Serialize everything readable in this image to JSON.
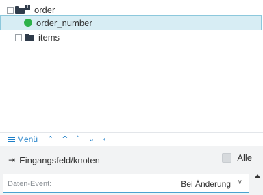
{
  "tree": {
    "nodes": [
      {
        "label": "order",
        "type": "folder-badged",
        "badge": "1"
      },
      {
        "label": "order_number",
        "type": "leaf",
        "status_color": "#2db24a"
      },
      {
        "label": "items",
        "type": "folder"
      }
    ]
  },
  "toolbar": {
    "menu_label": "Menü",
    "icons": [
      "double-chevron-up-icon",
      "chevron-up-icon",
      "chevron-down-icon",
      "double-chevron-down-icon",
      "chevron-left-icon"
    ]
  },
  "panel": {
    "field_label": "Eingangsfeld/knoten",
    "all_label": "Alle",
    "event": {
      "label": "Daten-Event:",
      "value": "Bei Änderung"
    }
  },
  "colors": {
    "accent": "#1e7fc8",
    "selection_bg": "#d7edf4",
    "selection_border": "#8cc8dc",
    "status_ok": "#2db24a"
  }
}
